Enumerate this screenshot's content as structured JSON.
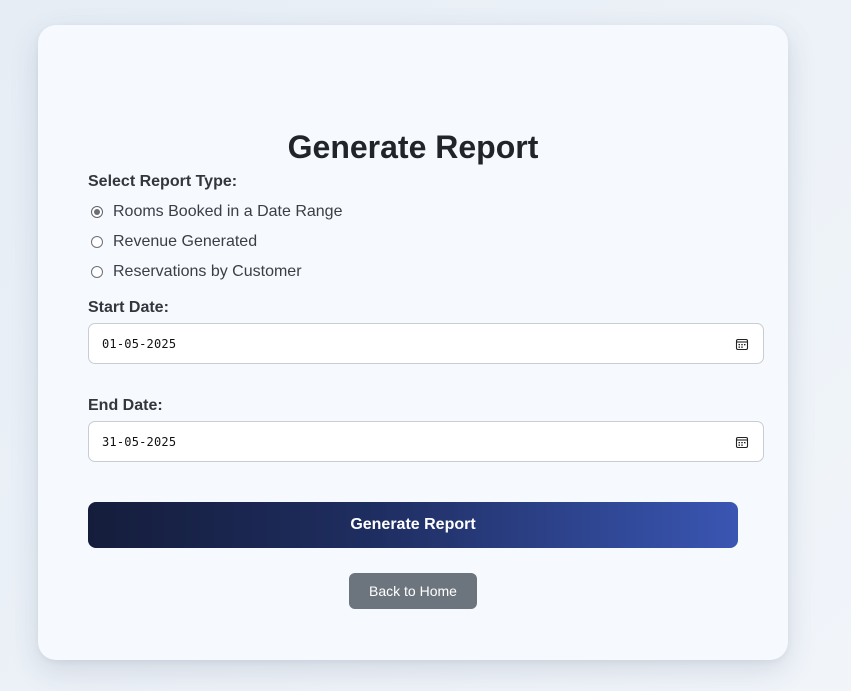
{
  "page": {
    "title": "Generate Report"
  },
  "report_type": {
    "label": "Select Report Type:",
    "options": [
      {
        "label": "Rooms Booked in a Date Range",
        "checked": true
      },
      {
        "label": "Revenue Generated",
        "checked": false
      },
      {
        "label": "Reservations by Customer",
        "checked": false
      }
    ]
  },
  "start_date": {
    "label": "Start Date:",
    "value": "01-05-2025",
    "icon": "calendar-icon"
  },
  "end_date": {
    "label": "End Date:",
    "value": "31-05-2025",
    "icon": "calendar-icon"
  },
  "buttons": {
    "generate_label": "Generate Report",
    "back_label": "Back to Home"
  },
  "colors": {
    "primary_gradient_start": "#151d3b",
    "primary_gradient_end": "#3a56b3",
    "secondary": "#6c757d",
    "card_bg": "#f6f9fd"
  }
}
